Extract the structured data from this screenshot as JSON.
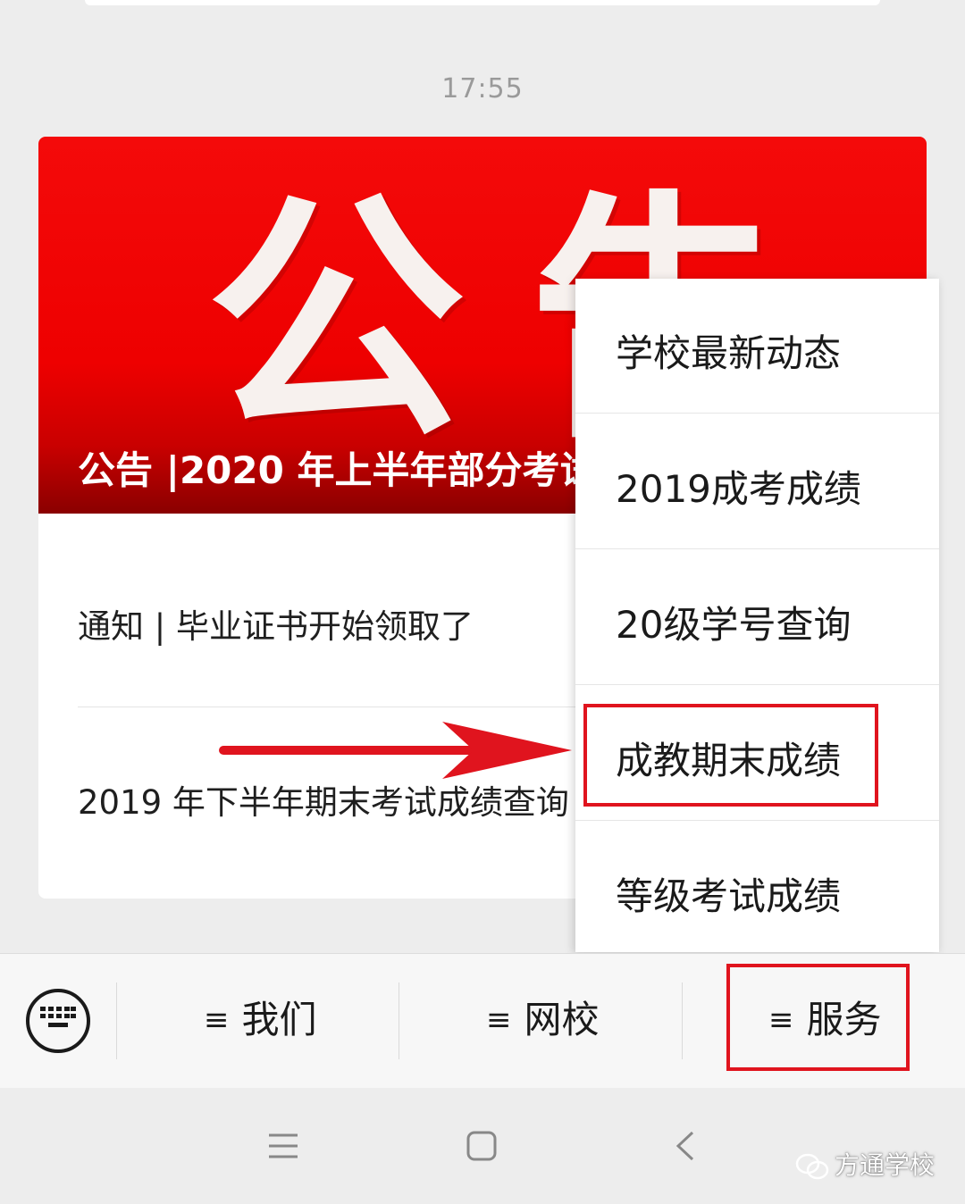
{
  "timestamp": "17:55",
  "card": {
    "banner_big_text": "公告",
    "banner_title": "公告 |2020 年上半年部分考试",
    "articles": [
      "通知 | 毕业证书开始领取了",
      "2019 年下半年期末考试成绩查询"
    ]
  },
  "menu": {
    "items": [
      "学校最新动态",
      "2019成考成绩",
      "20级学号查询",
      "成教期末成绩",
      "等级考试成绩"
    ],
    "highlighted_index": 3
  },
  "bottom_bar": {
    "keyboard_icon": "keyboard-icon",
    "tabs": [
      {
        "icon": "≡",
        "label": "我们"
      },
      {
        "icon": "≡",
        "label": "网校"
      },
      {
        "icon": "≡",
        "label": "服务"
      }
    ]
  },
  "system_nav": {
    "icons": [
      "menu-icon",
      "home-icon",
      "back-icon"
    ]
  },
  "watermark": "方通学校",
  "colors": {
    "banner_red": "#ee0000",
    "highlight_red": "#e0141e"
  }
}
